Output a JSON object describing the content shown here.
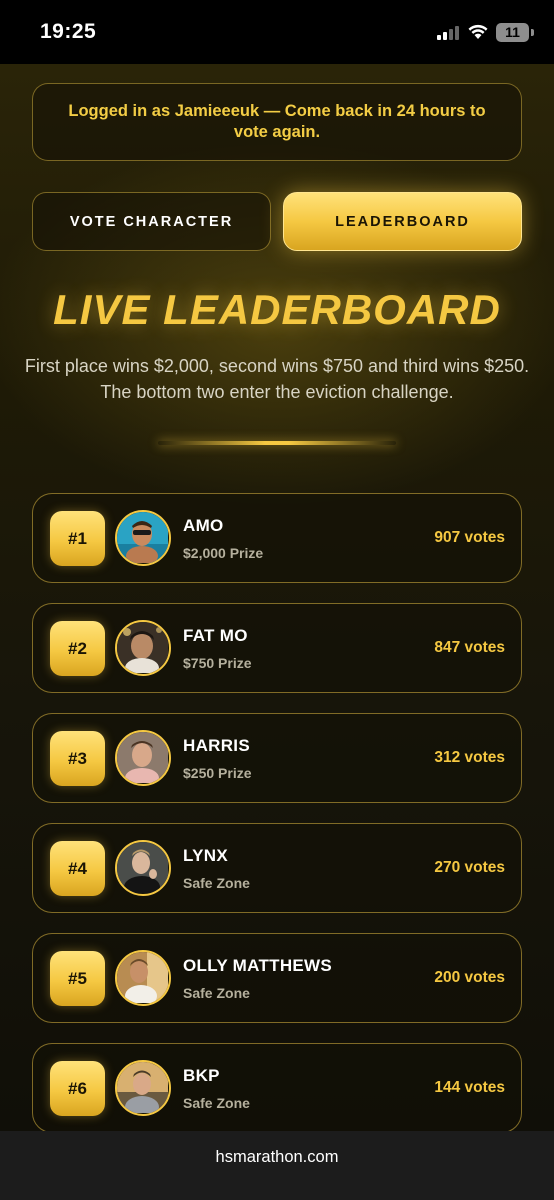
{
  "status_bar": {
    "time": "19:25",
    "battery": "11"
  },
  "login_banner": "Logged in as Jamieeeuk — Come back in 24 hours to vote again.",
  "tabs": {
    "vote": "VOTE CHARACTER",
    "leaderboard": "LEADERBOARD"
  },
  "title": "LIVE LEADERBOARD",
  "subtitle": "First place wins $2,000, second wins $750 and third wins $250. The bottom two enter the eviction challenge.",
  "leaderboard": [
    {
      "rank": "#1",
      "name": "AMO",
      "detail": "$2,000 Prize",
      "votes": "907 votes"
    },
    {
      "rank": "#2",
      "name": "FAT MO",
      "detail": "$750 Prize",
      "votes": "847 votes"
    },
    {
      "rank": "#3",
      "name": "HARRIS",
      "detail": "$250 Prize",
      "votes": "312 votes"
    },
    {
      "rank": "#4",
      "name": "LYNX",
      "detail": "Safe Zone",
      "votes": "270 votes"
    },
    {
      "rank": "#5",
      "name": "OLLY MATTHEWS",
      "detail": "Safe Zone",
      "votes": "200 votes"
    },
    {
      "rank": "#6",
      "name": "BKP",
      "detail": "Safe Zone",
      "votes": "144 votes"
    }
  ],
  "url": "hsmarathon.com",
  "colors": {
    "accent": "#f5c842",
    "background": "#1a1708"
  }
}
